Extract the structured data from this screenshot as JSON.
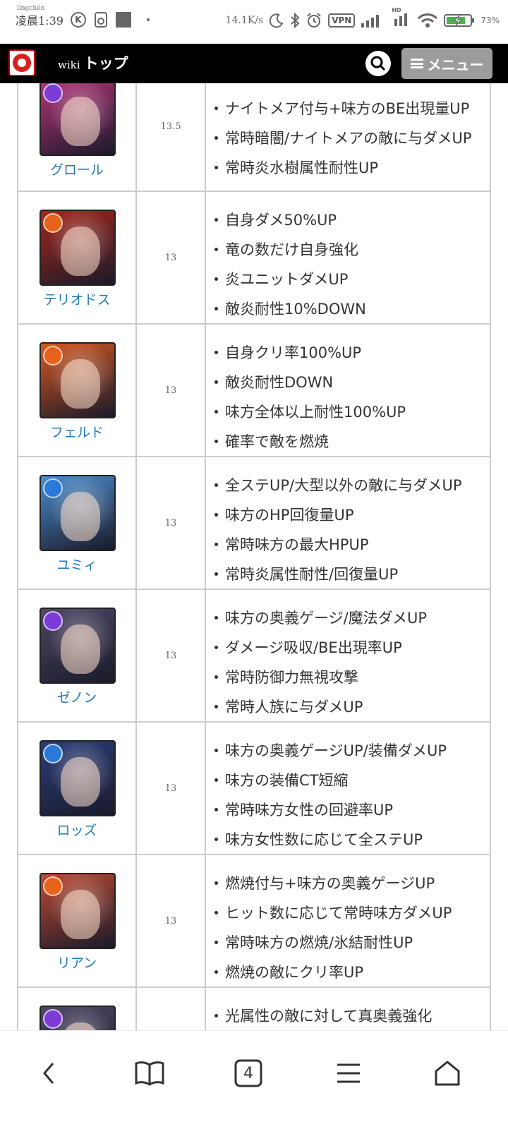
{
  "status_bar": {
    "time_ruby": "língchén",
    "time": "凌晨1:39",
    "k_badge": "K",
    "speed": "14.1K/s",
    "vpn": "VPN",
    "hd": "HD",
    "battery": "73%"
  },
  "header": {
    "wiki": "wiki",
    "top": "トップ",
    "menu_label": "メニュー"
  },
  "table": {
    "rows": [
      {
        "name": "グロール",
        "score": "13.5",
        "orb_color": "#7b3bd6",
        "bg_color": "#b8327a",
        "effects": [
          "ナイトメア付与+味方のBE出現量UP",
          "常時暗闇/ナイトメアの敵に与ダメUP",
          "常時炎水樹属性耐性UP"
        ]
      },
      {
        "name": "テリオドス",
        "score": "13",
        "orb_color": "#e8621c",
        "bg_color": "#a8261a",
        "effects": [
          "自身ダメ50%UP",
          "竜の数だけ自身強化",
          "炎ユニットダメUP",
          "敵炎耐性10%DOWN"
        ]
      },
      {
        "name": "フェルド",
        "score": "13",
        "orb_color": "#e8621c",
        "bg_color": "#d8571e",
        "effects": [
          "自身クリ率100%UP",
          "敵炎耐性DOWN",
          "味方全体以上耐性100%UP",
          "確率で敵を燃焼"
        ]
      },
      {
        "name": "ユミィ",
        "score": "13",
        "orb_color": "#2a78d8",
        "bg_color": "#4a8ed0",
        "effects": [
          "全ステUP/大型以外の敵に与ダメUP",
          "味方のHP回復量UP",
          "常時味方の最大HPUP",
          "常時炎属性耐性/回復量UP"
        ]
      },
      {
        "name": "ゼノン",
        "score": "13",
        "orb_color": "#7b3bd6",
        "bg_color": "#4e4866",
        "effects": [
          "味方の奥義ゲージ/魔法ダメUP",
          "ダメージ吸収/BE出現率UP",
          "常時防御力無視攻撃",
          "常時人族に与ダメUP"
        ]
      },
      {
        "name": "ロッズ",
        "score": "13",
        "orb_color": "#2a78d8",
        "bg_color": "#2a3e7a",
        "effects": [
          "味方の奥義ゲージUP/装備ダメUP",
          "味方の装備CT短縮",
          "常時味方女性の回避率UP",
          "味方女性数に応じて全ステUP"
        ]
      },
      {
        "name": "リアン",
        "score": "13",
        "orb_color": "#e8621c",
        "bg_color": "#c04a32",
        "effects": [
          "燃焼付与+味方の奥義ゲージUP",
          "ヒット数に応じて常時味方ダメUP",
          "常時味方の燃焼/氷結耐性UP",
          "燃焼の敵にクリ率UP"
        ]
      },
      {
        "name": "",
        "score": "",
        "orb_color": "#7b3bd6",
        "bg_color": "#4e4866",
        "effects": [
          "光属性の敵に対して真奥義強化"
        ]
      }
    ]
  },
  "bottom_nav": {
    "tabs_count": "4"
  }
}
